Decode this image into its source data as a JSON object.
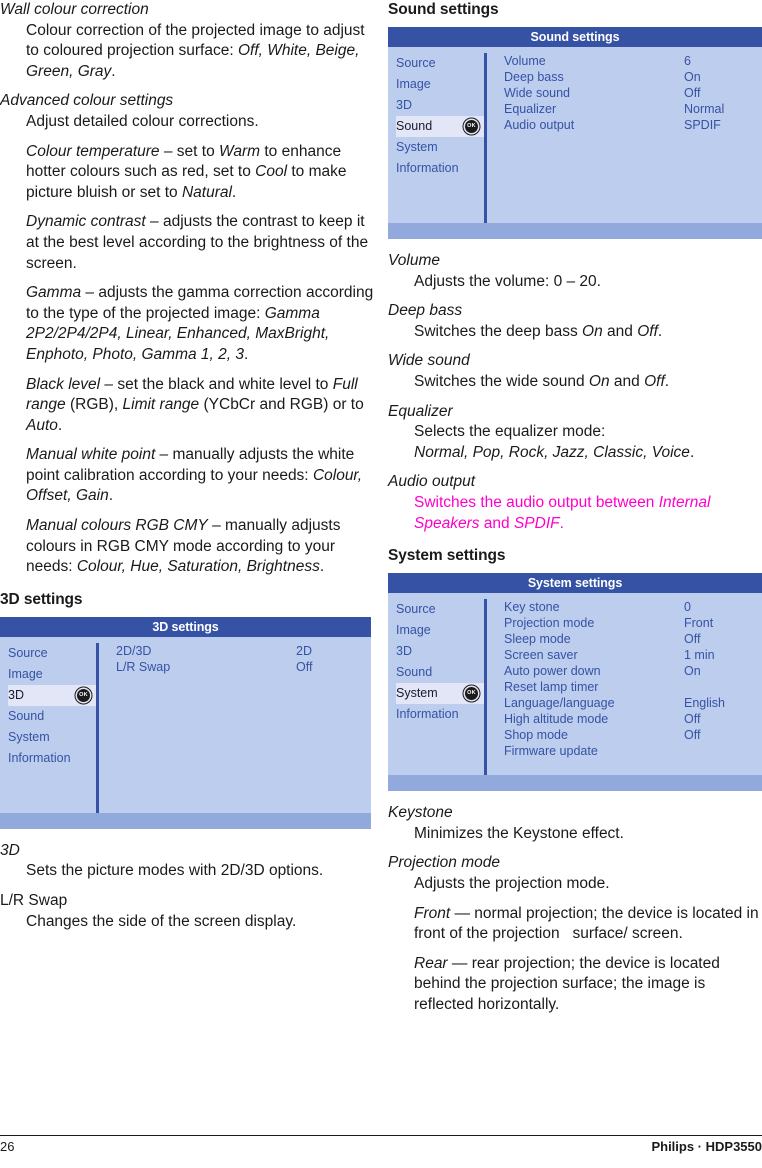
{
  "left_column": {
    "blocks": [
      {
        "kind": "term_desc",
        "term": "Wall colour correction",
        "term_italic": true,
        "desc_html": "Colour correction of the projected image to adjust to coloured projection surface: <i>Off, White, Beige, Green, Gray</i>."
      },
      {
        "kind": "term_desc",
        "term": "Advanced colour settings",
        "term_italic": true,
        "desc_html": "Adjust detailed colour corrections."
      },
      {
        "kind": "sub",
        "text_html": "<i>Colour temperature</i> – set to <i>Warm</i> to enhance hotter colours such as red, set to <i>Cool</i> to make picture bluish or set to <i>Natural</i>."
      },
      {
        "kind": "sub",
        "text_html": "<i>Dynamic contrast</i> – adjusts the contrast to keep it at the best level according to the brightness of the screen."
      },
      {
        "kind": "sub",
        "text_html": "<i>Gamma</i> – adjusts the gamma correction according to the type of the projected image: <i>Gamma 2P2/2P4/2P4, Linear, Enhanced, MaxBright, Enphoto, Photo, Gamma 1, 2, 3</i>."
      },
      {
        "kind": "sub",
        "text_html": "<i>Black level</i> – set the black and white level to <i>Full range</i> (RGB), <i>Limit range</i> (YCbCr and RGB) or to <i>Auto</i>."
      },
      {
        "kind": "sub",
        "text_html": "<i>Manual white point</i> – manually adjusts the white point calibration according to your needs: <i>Colour, Offset, Gain</i>."
      },
      {
        "kind": "sub",
        "text_html": "<i>Manual colours RGB CMY</i> – manually adjusts colours in RGB CMY mode according to your needs: <i>Colour, Hue, Saturation, Brightness</i>."
      }
    ],
    "heading_3d": "3D settings",
    "after_blocks": [
      {
        "kind": "term_desc",
        "term": "3D",
        "term_italic": true,
        "desc_html": "Sets the picture modes with 2D/3D options."
      },
      {
        "kind": "term_desc",
        "term": "L/R Swap",
        "term_italic": false,
        "desc_html": "Changes the side of the screen display."
      }
    ]
  },
  "right_column": {
    "heading_sound": "Sound settings",
    "blocks_sound": [
      {
        "kind": "term_desc",
        "term": "Volume",
        "term_italic": true,
        "desc_html": "Adjusts the volume: 0 – 20."
      },
      {
        "kind": "term_desc",
        "term": "Deep bass",
        "term_italic": true,
        "desc_html": "Switches the deep bass <i>On</i> and <i>Off</i>."
      },
      {
        "kind": "term_desc",
        "term": "Wide sound",
        "term_italic": true,
        "desc_html": "Switches the wide sound <i>On</i> and <i>Off</i>."
      },
      {
        "kind": "term_desc",
        "term": "Equalizer",
        "term_italic": true,
        "desc_html": "Selects the equalizer mode:<br><i>Normal, Pop, Rock, Jazz, Classic, Voice</i>."
      },
      {
        "kind": "term_desc",
        "term": "Audio output",
        "term_italic": true,
        "desc_html": "<span class=\"magenta\">Switches the audio output between <i>Internal Speakers</i> and <i>SPDIF</i>.</span>"
      }
    ],
    "heading_system": "System settings",
    "blocks_system": [
      {
        "kind": "term_desc",
        "term": "Keystone",
        "term_italic": true,
        "desc_html": "Minimizes the Keystone effect."
      },
      {
        "kind": "term_desc",
        "term": "Projection mode",
        "term_italic": true,
        "desc_html": "Adjusts the projection mode."
      },
      {
        "kind": "sub",
        "text_html": "<i>Front</i> — normal projection; the device is located in front of the projection &nbsp; surface/ screen."
      },
      {
        "kind": "sub",
        "text_html": "<i>Rear</i> — rear projection; the device is located behind the projection surface; the image is reflected horizontally."
      }
    ]
  },
  "menus": {
    "nav_items": [
      "Source",
      "Image",
      "3D",
      "Sound",
      "System",
      "Information"
    ],
    "ok_badge_label": "OK",
    "three_d": {
      "title": "3D settings",
      "selected_nav": "3D",
      "rows": [
        {
          "label": "2D/3D",
          "value": "2D"
        },
        {
          "label": "L/R Swap",
          "value": "Off"
        }
      ]
    },
    "sound": {
      "title": "Sound settings",
      "selected_nav": "Sound",
      "rows": [
        {
          "label": "Volume",
          "value": "6"
        },
        {
          "label": "Deep bass",
          "value": "On"
        },
        {
          "label": "Wide sound",
          "value": "Off"
        },
        {
          "label": "Equalizer",
          "value": "Normal"
        },
        {
          "label": "Audio output",
          "value": "SPDIF"
        }
      ]
    },
    "system": {
      "title": "System settings",
      "selected_nav": "System",
      "rows": [
        {
          "label": "Key stone",
          "value": "0"
        },
        {
          "label": "Projection mode",
          "value": "Front"
        },
        {
          "label": "Sleep mode",
          "value": "Off"
        },
        {
          "label": "Screen saver",
          "value": "1 min"
        },
        {
          "label": "Auto power down",
          "value": "On"
        },
        {
          "label": "Reset lamp timer",
          "value": ""
        },
        {
          "label": "Language/language",
          "value": "English"
        },
        {
          "label": "High altitude mode",
          "value": "Off"
        },
        {
          "label": "Shop mode",
          "value": "Off"
        },
        {
          "label": "Firmware update",
          "value": ""
        }
      ]
    }
  },
  "footer": {
    "page_number": "26",
    "brand": "Philips · HDP3550"
  },
  "colors": {
    "menu_title_bar": "#3652a4",
    "menu_body": "#bccdee",
    "menu_foot": "#92a9dd",
    "menu_text": "#3652a4",
    "menu_selected_bg": "#e2e6f6",
    "highlight_magenta": "#ff00cc"
  }
}
